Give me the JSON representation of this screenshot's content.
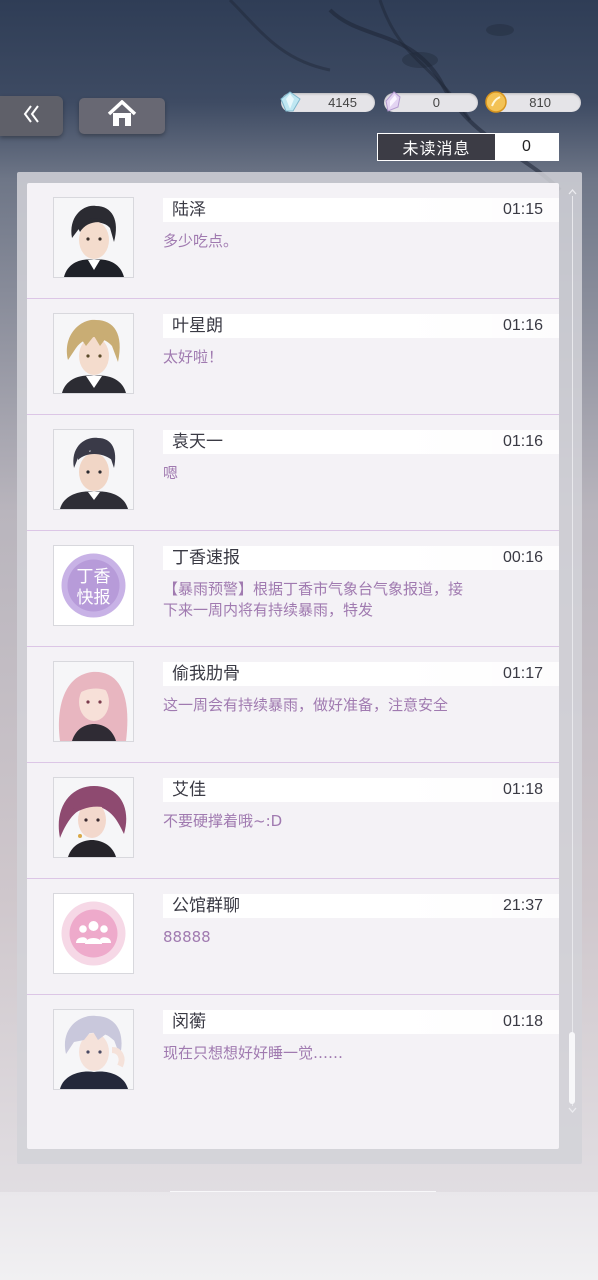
{
  "header": {
    "back_icon": "double-chevron-left-icon",
    "home_icon": "home-icon",
    "currencies": [
      {
        "name": "diamond",
        "icon": "diamond-gem-icon",
        "value": "4145"
      },
      {
        "name": "crystal",
        "icon": "crystal-shard-icon",
        "value": "0"
      },
      {
        "name": "coin",
        "icon": "gold-coin-icon",
        "value": "810"
      }
    ],
    "unread": {
      "label": "未读消息",
      "count": "0"
    }
  },
  "messages": [
    {
      "name": "陆泽",
      "time": "01:15",
      "text": "多少吃点。",
      "avatar": "portrait-dark-hair"
    },
    {
      "name": "叶星朗",
      "time": "01:16",
      "text": "太好啦！",
      "avatar": "portrait-blond-hair"
    },
    {
      "name": "袁天一",
      "time": "01:16",
      "text": "嗯",
      "avatar": "portrait-short-dark-hair"
    },
    {
      "name": "丁香速报",
      "time": "00:16",
      "text": "【暴雨预警】根据丁香市气象台气象报道，接下来一周内将有持续暴雨，特发",
      "avatar": "news-logo",
      "logo": {
        "top": "丁香",
        "bottom": "快报"
      }
    },
    {
      "name": "偷我肋骨",
      "time": "01:17",
      "text": "这一周会有持续暴雨，做好准备，注意安全",
      "avatar": "portrait-pink-hair"
    },
    {
      "name": "艾佳",
      "time": "01:18",
      "text": "不要硬撑着哦~:D",
      "avatar": "portrait-purple-hair"
    },
    {
      "name": "公馆群聊",
      "time": "21:37",
      "text": "88888",
      "avatar": "group-chat-icon"
    },
    {
      "name": "闵蘅",
      "time": "01:18",
      "text": "现在只想想好好睡一觉……",
      "avatar": "portrait-silver-hair"
    }
  ],
  "colors": {
    "message_text": "#a07ab0",
    "divider": "#dcc6e6",
    "button_bg": "#686873"
  }
}
